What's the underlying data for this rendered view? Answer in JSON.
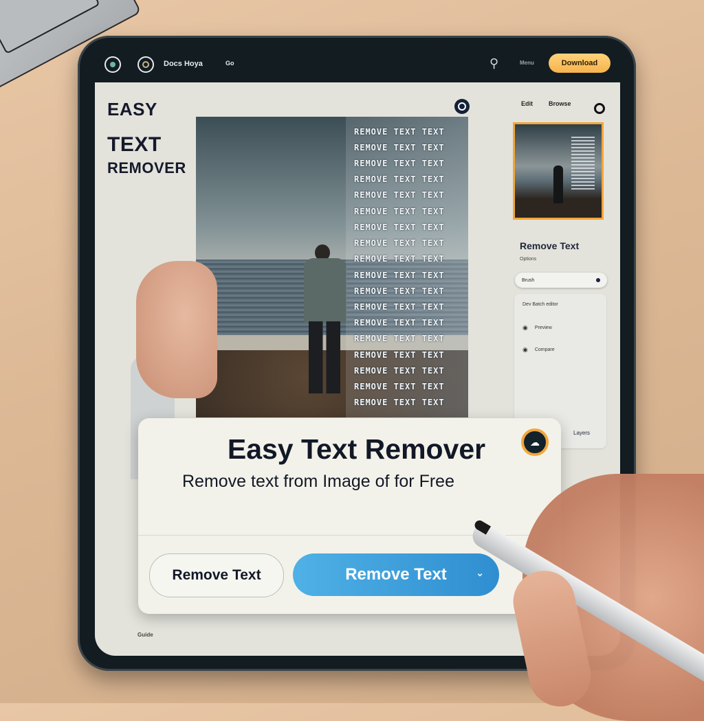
{
  "header": {
    "nav_label": "Docs Hoya",
    "secondary_label": "Go",
    "user_icon": "user-icon",
    "menu_label": "Menu",
    "cta_label": "Download"
  },
  "sidebar": {
    "logo_line1": "EASY",
    "logo_line2": "TEXT",
    "logo_line3": "REMOVER",
    "footer_label": "Guide"
  },
  "preview": {
    "overlay_lines": [
      "REMOVE TEXT TEXT",
      "REMOVE TEXT TEXT",
      "REMOVE TEXT TEXT",
      "REMOVE TEXT TEXT",
      "REMOVE TEXT TEXT",
      "REMOVE TEXT TEXT",
      "REMOVE TEXT TEXT",
      "REMOVE TEXT TEXT",
      "REMOVE TEXT TEXT",
      "REMOVE TEXT TEXT",
      "REMOVE TEXT TEXT",
      "REMOVE TEXT TEXT",
      "REMOVE TEXT TEXT",
      "REMOVE TEXT TEXT",
      "REMOVE TEXT TEXT",
      "REMOVE TEXT TEXT",
      "REMOVE TEXT TEXT",
      "REMOVE TEXT TEXT"
    ]
  },
  "right_panel": {
    "top_link1": "Edit",
    "top_link2": "Browse",
    "title": "Remove Text",
    "subtitle": "Options",
    "select_value": "Brush",
    "list_header": "Dev Batch editor",
    "items": [
      {
        "icon": "eye-icon",
        "label": "Preview"
      },
      {
        "icon": "eye-icon",
        "label": "Compare"
      }
    ],
    "footer_label": "Layers"
  },
  "dialog": {
    "title": "Easy Text Remover",
    "subtitle": "Remove text from Image of for Free",
    "secondary_button": "Remove Text",
    "primary_button": "Remove Text"
  },
  "colors": {
    "accent_orange": "#f2a63a",
    "primary_blue": "#3a9fdc",
    "tablet_frame": "#121c21"
  }
}
